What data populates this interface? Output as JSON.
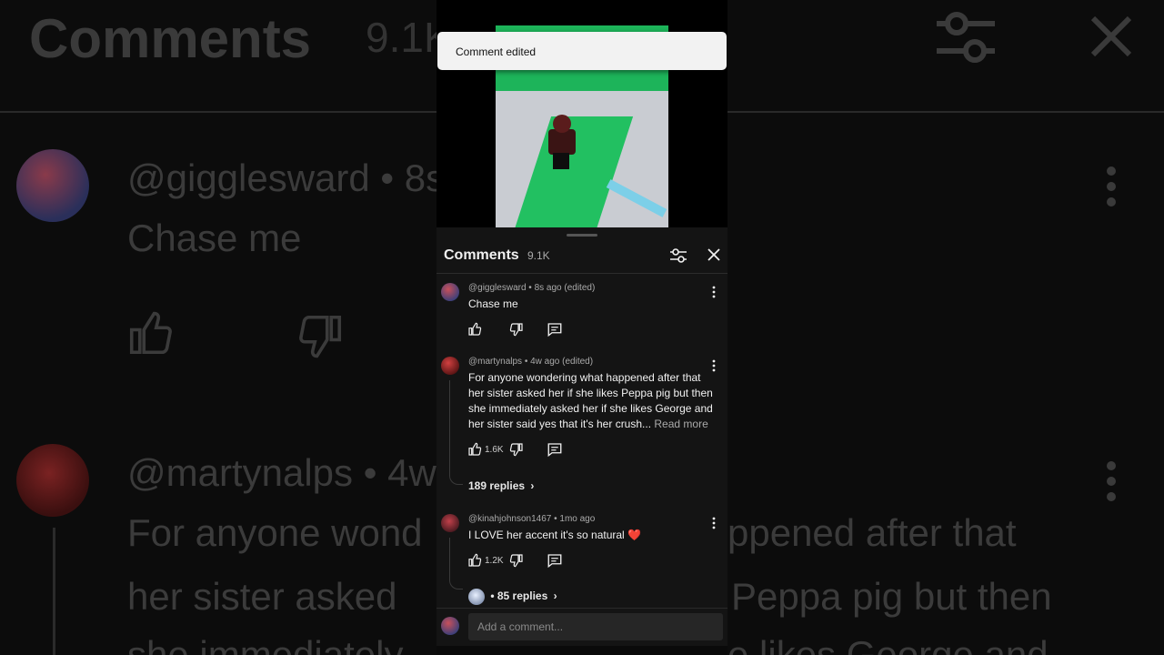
{
  "background": {
    "title": "Comments",
    "count": "9.1K",
    "c1_user": "@gigglesward • 8s",
    "c1_text": "Chase me",
    "c2_user": "@martynalps • 4w",
    "c2_line1_left": "For anyone wond",
    "c2_line1_right": "ppened after that",
    "c2_line2_left": "her sister asked",
    "c2_line2_right": "Peppa pig but then",
    "c2_line3_left": "she immediately",
    "c2_line3_right": "e likes George and"
  },
  "toast": {
    "message": "Comment edited"
  },
  "sheet": {
    "title": "Comments",
    "count": "9.1K"
  },
  "comments": [
    {
      "author": "@gigglesward",
      "meta": "@gigglesward • 8s ago (edited)",
      "text": "Chase me",
      "likes": ""
    },
    {
      "author": "@martynalps",
      "meta": "@martynalps • 4w ago (edited)",
      "text": "For anyone wondering what happened after that her sister asked her if she likes Peppa pig but then she immediately asked her if she likes George and her sister said yes that it's her crush...",
      "read_more": "Read more",
      "likes": "1.6K",
      "replies": "189 replies"
    },
    {
      "author": "@kinahjohnson1467",
      "meta": "@kinahjohnson1467 • 1mo ago",
      "text": "I LOVE her  accent it's so natural ❤️",
      "likes": "1.2K",
      "replies": "• 85 replies"
    }
  ],
  "composer": {
    "placeholder": "Add a comment..."
  },
  "colors": {
    "accent_toast_bg": "#f2f2f2",
    "sheet_bg": "#141414",
    "video_green": "#1db45a"
  }
}
